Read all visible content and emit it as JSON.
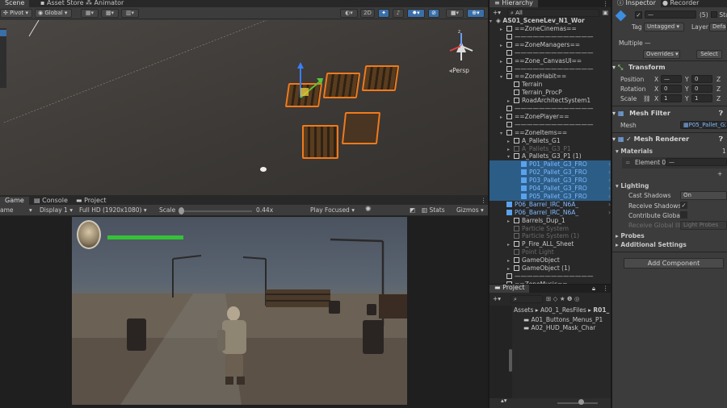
{
  "scene_panel": {
    "tabs": [
      "Scene",
      "Asset Store",
      "Animator"
    ],
    "pivot": "Pivot",
    "global": "Global",
    "mode_2d": "2D",
    "persp": "Persp"
  },
  "game_panel": {
    "tabs": [
      "Game",
      "Console",
      "Project"
    ],
    "view_label": "ame",
    "display": "Display 1",
    "resolution": "Full HD (1920x1080)",
    "scale_label": "Scale",
    "scale_value": "0.44x",
    "play_mode": "Play Focused",
    "stats": "Stats",
    "gizmos": "Gizmos",
    "health_fraction": 1.0
  },
  "hierarchy": {
    "tab": "Hierarchy",
    "search": "All",
    "scene_name": "AS01_SceneLev_N1_Wor",
    "rows": [
      {
        "label": "==ZoneCinemas==",
        "indent": 1,
        "kind": "normal",
        "arrow": "▸"
      },
      {
        "label": "—————————————",
        "indent": 1,
        "kind": "normal",
        "arrow": ""
      },
      {
        "label": "==ZoneManagers==",
        "indent": 1,
        "kind": "normal",
        "arrow": "▸"
      },
      {
        "label": "—————————————",
        "indent": 1,
        "kind": "normal",
        "arrow": ""
      },
      {
        "label": "==Zone_CanvasUI==",
        "indent": 1,
        "kind": "normal",
        "arrow": "▸"
      },
      {
        "label": "—————————————",
        "indent": 1,
        "kind": "normal",
        "arrow": ""
      },
      {
        "label": "==ZoneHabit==",
        "indent": 1,
        "kind": "normal",
        "arrow": "▾"
      },
      {
        "label": "Terrain",
        "indent": 2,
        "kind": "normal",
        "arrow": ""
      },
      {
        "label": "Terrain_ProcP",
        "indent": 2,
        "kind": "normal",
        "arrow": ""
      },
      {
        "label": "RoadArchitectSystem1",
        "indent": 2,
        "kind": "normal",
        "arrow": "▸"
      },
      {
        "label": "—————————————",
        "indent": 1,
        "kind": "normal",
        "arrow": ""
      },
      {
        "label": "==ZonePlayer==",
        "indent": 1,
        "kind": "normal",
        "arrow": "▸"
      },
      {
        "label": "—————————————",
        "indent": 1,
        "kind": "normal",
        "arrow": ""
      },
      {
        "label": "==ZoneItems==",
        "indent": 1,
        "kind": "normal",
        "arrow": "▾"
      },
      {
        "label": "A_Pallets_G1",
        "indent": 2,
        "kind": "normal",
        "arrow": "▸"
      },
      {
        "label": "A_Pallets_G3_P1",
        "indent": 2,
        "kind": "dis",
        "arrow": "▸"
      },
      {
        "label": "A_Pallets_G3_P1 (1)",
        "indent": 2,
        "kind": "normal",
        "arrow": "▾"
      },
      {
        "label": "P01_Pallet_G3_FRO",
        "indent": 3,
        "kind": "prefab sel",
        "arrow": ""
      },
      {
        "label": "P02_Pallet_G3_FRO",
        "indent": 3,
        "kind": "prefab sel",
        "arrow": ""
      },
      {
        "label": "P03_Pallet_G3_FRO",
        "indent": 3,
        "kind": "prefab sel",
        "arrow": ""
      },
      {
        "label": "P04_Pallet_G3_FRO",
        "indent": 3,
        "kind": "prefab sel",
        "arrow": ""
      },
      {
        "label": "P05_Pallet_G3_FRO",
        "indent": 3,
        "kind": "prefab sel",
        "arrow": ""
      },
      {
        "label": "P06_Barrel_IRC_N6A_",
        "indent": 1,
        "kind": "prefab",
        "arrow": ""
      },
      {
        "label": "P06_Barrel_IRC_N6A_",
        "indent": 1,
        "kind": "prefab",
        "arrow": ""
      },
      {
        "label": "Barrels_Dup_1",
        "indent": 2,
        "kind": "normal",
        "arrow": "▸"
      },
      {
        "label": "Particle System",
        "indent": 2,
        "kind": "dis",
        "arrow": ""
      },
      {
        "label": "Particle System (1)",
        "indent": 2,
        "kind": "dis",
        "arrow": ""
      },
      {
        "label": "P_Fire_ALL_Sheet",
        "indent": 2,
        "kind": "normal",
        "arrow": "▸"
      },
      {
        "label": "Point Light",
        "indent": 2,
        "kind": "dis",
        "arrow": ""
      },
      {
        "label": "GameObject",
        "indent": 2,
        "kind": "normal",
        "arrow": "▸"
      },
      {
        "label": "GameObject (1)",
        "indent": 2,
        "kind": "normal",
        "arrow": "▸"
      },
      {
        "label": "—————————————",
        "indent": 1,
        "kind": "normal",
        "arrow": ""
      },
      {
        "label": "==ZoneMusic==",
        "indent": 1,
        "kind": "normal",
        "arrow": "▸"
      }
    ]
  },
  "project_panel": {
    "tab": "Project",
    "breadcrumb": [
      "Assets",
      "A00_1_ResFiles",
      "R01_"
    ],
    "folders": [
      "A01_Buttons_Menus_P1",
      "A02_HUD_Mask_Char"
    ]
  },
  "inspector": {
    "tabs": [
      "Inspector",
      "Recorder"
    ],
    "name_value": "—",
    "count": "(5)",
    "static_label": "Sta",
    "tag_label": "Tag",
    "tag_value": "Untagged",
    "layer_label": "Layer",
    "layer_value": "Defau",
    "multiple_label": "Multiple",
    "multiple_value": "—",
    "overrides": "Overrides",
    "select": "Select",
    "transform": {
      "title": "Transform",
      "position_label": "Position",
      "rotation_label": "Rotation",
      "scale_label": "Scale",
      "x": "X",
      "y": "Y",
      "z": "Z",
      "pos_x": "—",
      "pos_y": "0",
      "pos_z": "Z",
      "rot_x": "0",
      "rot_y": "0",
      "rot_z": "Z",
      "scl_x": "1",
      "scl_y": "1",
      "scl_z": "Z"
    },
    "mesh_filter": {
      "title": "Mesh Filter",
      "mesh_label": "Mesh",
      "mesh_value": "P05_Pallet_G3"
    },
    "mesh_renderer": {
      "title": "Mesh Renderer",
      "materials_label": "Materials",
      "materials_count": "1",
      "element0_label": "Element 0",
      "element0_value": "—"
    },
    "lighting": {
      "title": "Lighting",
      "cast_shadows_label": "Cast Shadows",
      "cast_shadows_value": "On",
      "receive_shadows_label": "Receive Shadows",
      "receive_shadows_check": "✓",
      "contribute_gi_label": "Contribute Global",
      "receive_gi_label": "Receive Global Illu",
      "receive_gi_value": "Light Probes"
    },
    "probes": "Probes",
    "additional_settings": "Additional Settings",
    "add_component": "Add Component"
  },
  "colors": {
    "accent_blue": "#3a6fa8",
    "selection": "#2c5d87",
    "prefab_text": "#7fb8ff",
    "pallet_outline": "#f07a1c",
    "health_green": "#35c239"
  }
}
